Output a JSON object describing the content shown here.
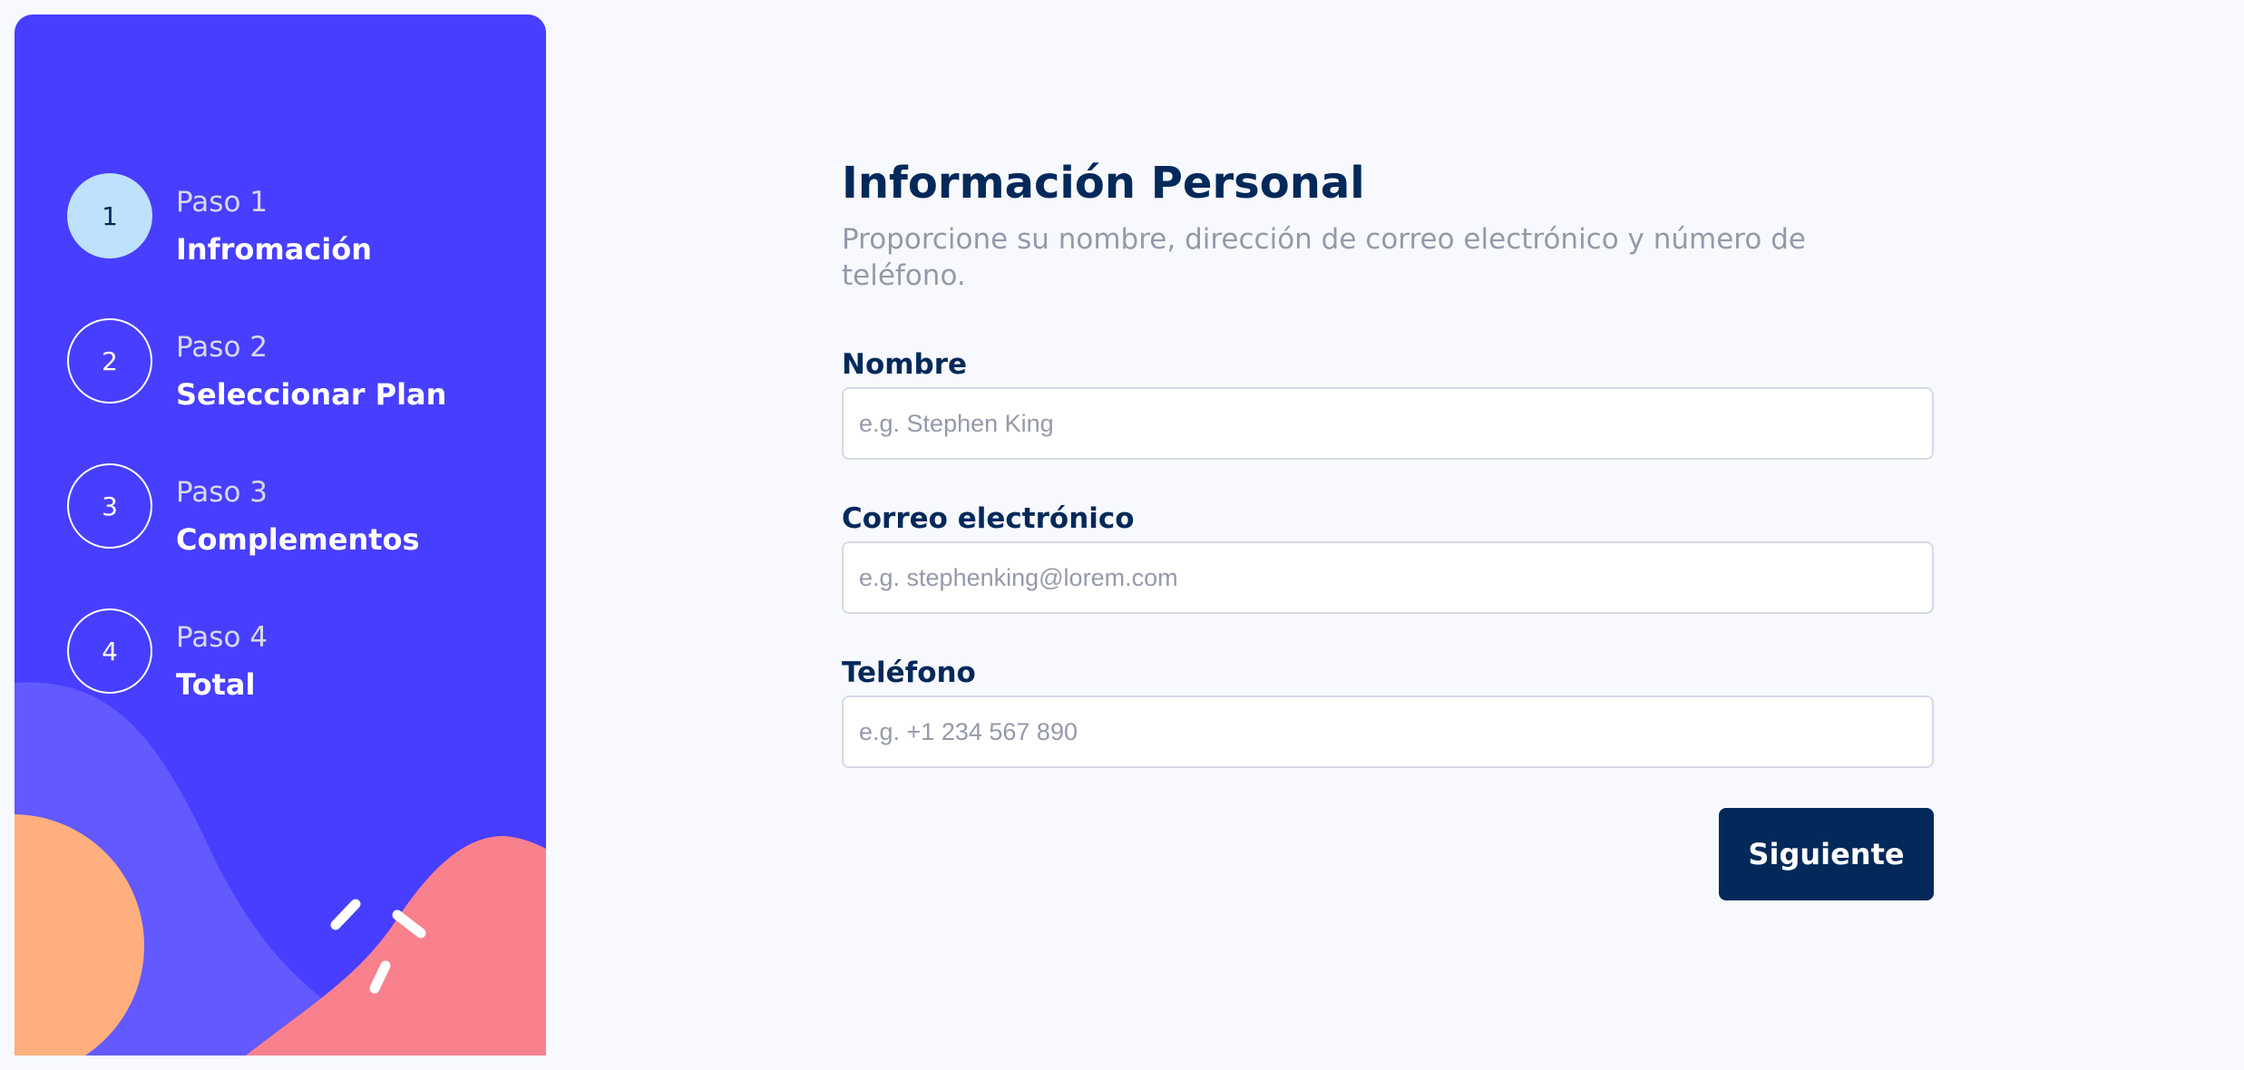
{
  "sidebar": {
    "steps": [
      {
        "number": "1",
        "label": "Paso 1",
        "name": "Infromación",
        "active": true
      },
      {
        "number": "2",
        "label": "Paso 2",
        "name": "Seleccionar Plan",
        "active": false
      },
      {
        "number": "3",
        "label": "Paso 3",
        "name": "Complementos",
        "active": false
      },
      {
        "number": "4",
        "label": "Paso 4",
        "name": "Total",
        "active": false
      }
    ]
  },
  "main": {
    "title": "Información Personal",
    "subtitle": "Proporcione su nombre, dirección de correo electrónico y número de teléfono.",
    "fields": [
      {
        "label": "Nombre",
        "value": "",
        "placeholder": "e.g. Stephen King"
      },
      {
        "label": "Correo electrónico",
        "value": "",
        "placeholder": "e.g. stephenking@lorem.com"
      },
      {
        "label": "Teléfono",
        "value": "",
        "placeholder": "e.g. +1 234 567 890"
      }
    ],
    "next_button": "Siguiente"
  },
  "colors": {
    "sidebar_bg": "#483eff",
    "active_step": "#bee2fd",
    "primary": "#02295a",
    "muted": "#9699ab",
    "border": "#d6d9e6",
    "page_bg": "#f8f9fe",
    "blob_purple": "#6259ff",
    "blob_orange": "#ffaf7e",
    "blob_pink": "#f9818e"
  }
}
